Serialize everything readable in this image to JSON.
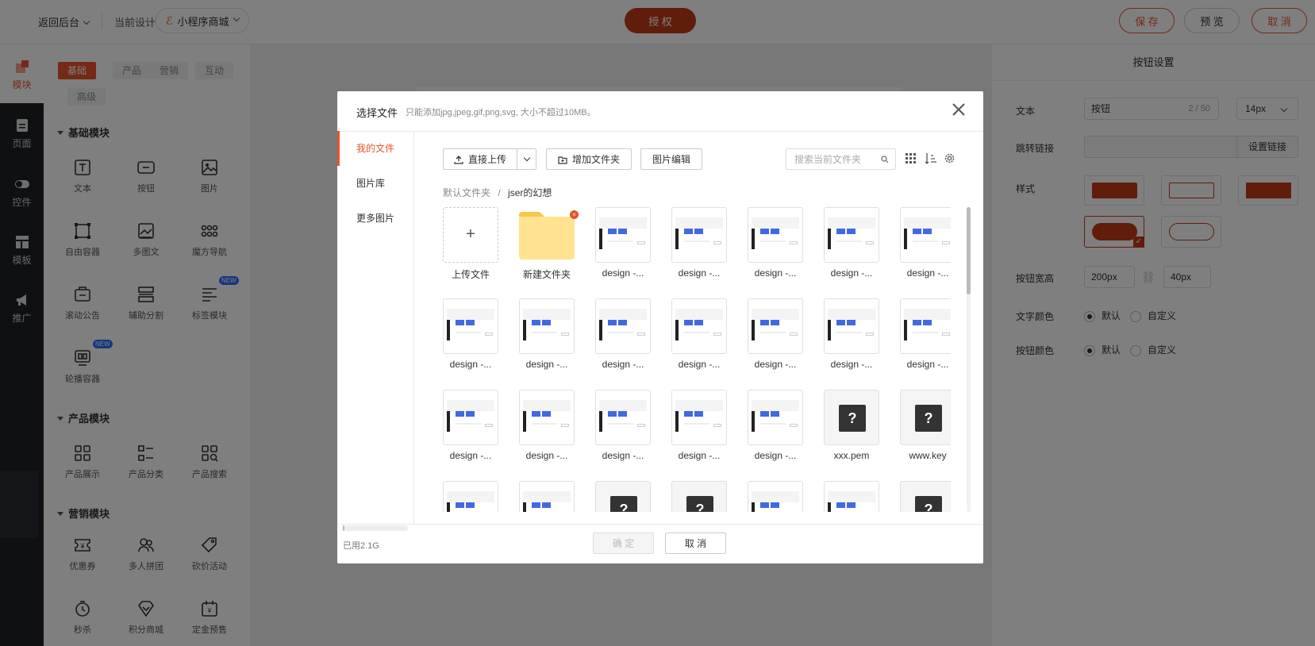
{
  "topbar": {
    "back_label": "返回后台",
    "current_design_label": "当前设计",
    "mini_app_label": "小程序商城",
    "authorize_label": "授 权",
    "save_label": "保 存",
    "preview_label": "预 览",
    "cancel_label": "取 消"
  },
  "rail": {
    "items": [
      {
        "label": "模块",
        "icon": "module-icon"
      },
      {
        "label": "页面",
        "icon": "page-icon"
      },
      {
        "label": "控件",
        "icon": "toggle-icon"
      },
      {
        "label": "模板",
        "icon": "template-icon"
      },
      {
        "label": "推广",
        "icon": "megaphone-icon"
      }
    ]
  },
  "modules": {
    "tabs": [
      "基础",
      "产品",
      "营销",
      "互动",
      "高级"
    ],
    "sections": [
      {
        "title": "基础模块",
        "items": [
          {
            "label": "文本",
            "icon": "text-icon"
          },
          {
            "label": "按钮",
            "icon": "button-icon"
          },
          {
            "label": "图片",
            "icon": "image-icon"
          },
          {
            "label": "自由容器",
            "icon": "free-container-icon"
          },
          {
            "label": "多图文",
            "icon": "multi-image-icon"
          },
          {
            "label": "魔方导航",
            "icon": "cube-nav-icon"
          },
          {
            "label": "滚动公告",
            "icon": "notice-icon"
          },
          {
            "label": "辅助分割",
            "icon": "divider-icon"
          },
          {
            "label": "标签模块",
            "icon": "tag-icon",
            "badge": "NEW"
          },
          {
            "label": "轮播容器",
            "icon": "carousel-icon",
            "badge": "NEW"
          }
        ]
      },
      {
        "title": "产品模块",
        "items": [
          {
            "label": "产品展示",
            "icon": "product-grid-icon"
          },
          {
            "label": "产品分类",
            "icon": "product-category-icon"
          },
          {
            "label": "产品搜索",
            "icon": "product-search-icon"
          }
        ]
      },
      {
        "title": "营销模块",
        "items": [
          {
            "label": "优惠券",
            "icon": "coupon-icon"
          },
          {
            "label": "多人拼团",
            "icon": "group-buy-icon"
          },
          {
            "label": "砍价活动",
            "icon": "bargain-icon"
          },
          {
            "label": "秒杀",
            "icon": "flash-sale-icon"
          },
          {
            "label": "积分商城",
            "icon": "points-mall-icon"
          },
          {
            "label": "定金预售",
            "icon": "presale-icon"
          }
        ]
      }
    ]
  },
  "settings": {
    "title": "按钮设置",
    "text_label": "文本",
    "text_value": "按钮",
    "text_count": "2 / 50",
    "font_size": "14px",
    "link_label": "跳转链接",
    "link_button": "设置链接",
    "style_label": "样式",
    "size_label": "按钮宽高",
    "width": "200px",
    "height": "40px",
    "text_color_label": "文字颜色",
    "button_color_label": "按钮颜色",
    "default_option": "默认",
    "custom_option": "自定义",
    "accent_color": "#e8542c"
  },
  "modal": {
    "title": "选择文件",
    "subtitle": "只能添加jpg,jpeg,gif,png,svg, 大小不超过10MB。",
    "side_items": [
      "我的文件",
      "图片库",
      "更多图片"
    ],
    "usage": "已用2.1G",
    "usage_fraction": 0.03,
    "toolbar": {
      "direct_upload": "直接上传",
      "add_folder": "增加文件夹",
      "image_edit": "图片编辑",
      "search_placeholder": "搜索当前文件夹"
    },
    "breadcrumb": {
      "root": "默认文件夹",
      "separator": "/",
      "current": "jser的幻想"
    },
    "upload_label": "上传文件",
    "new_folder_label": "新建文件夹",
    "files": [
      {
        "name": "design -...",
        "kind": "design"
      },
      {
        "name": "design -...",
        "kind": "design"
      },
      {
        "name": "design -...",
        "kind": "design"
      },
      {
        "name": "design -...",
        "kind": "design"
      },
      {
        "name": "design -...",
        "kind": "design"
      },
      {
        "name": "design -...",
        "kind": "design"
      },
      {
        "name": "design -...",
        "kind": "design"
      },
      {
        "name": "design -...",
        "kind": "design"
      },
      {
        "name": "design -...",
        "kind": "design"
      },
      {
        "name": "design -...",
        "kind": "design"
      },
      {
        "name": "design -...",
        "kind": "design"
      },
      {
        "name": "design -...",
        "kind": "design"
      },
      {
        "name": "design -...",
        "kind": "design"
      },
      {
        "name": "design -...",
        "kind": "design"
      },
      {
        "name": "design -...",
        "kind": "design"
      },
      {
        "name": "design -...",
        "kind": "design"
      },
      {
        "name": "design -...",
        "kind": "design"
      },
      {
        "name": "xxx.pem",
        "kind": "unknown"
      },
      {
        "name": "www.key",
        "kind": "unknown"
      },
      {
        "name": "",
        "kind": "design"
      },
      {
        "name": "",
        "kind": "design"
      },
      {
        "name": "",
        "kind": "unknown"
      },
      {
        "name": "",
        "kind": "unknown"
      },
      {
        "name": "",
        "kind": "design"
      },
      {
        "name": "",
        "kind": "design"
      },
      {
        "name": "",
        "kind": "unknown"
      }
    ],
    "confirm_label": "确 定",
    "cancel_label": "取 消"
  }
}
